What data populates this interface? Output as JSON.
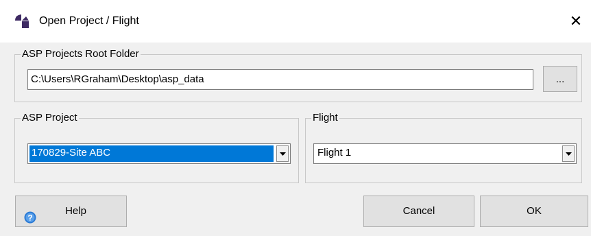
{
  "window": {
    "title": "Open Project / Flight",
    "close_symbol": "✕",
    "app_icon": "project-logo-icon"
  },
  "root_folder": {
    "label": "ASP Projects Root Folder",
    "path": "C:\\Users\\RGraham\\Desktop\\asp_data",
    "browse_label": "..."
  },
  "project": {
    "label": "ASP Project",
    "selected": "170829-Site ABC"
  },
  "flight": {
    "label": "Flight",
    "selected": "Flight 1"
  },
  "buttons": {
    "help": "Help",
    "cancel": "Cancel",
    "ok": "OK"
  },
  "colors": {
    "accent": "#0078d7",
    "logo": "#3e2a63",
    "help_icon": "#2a7ad5"
  }
}
